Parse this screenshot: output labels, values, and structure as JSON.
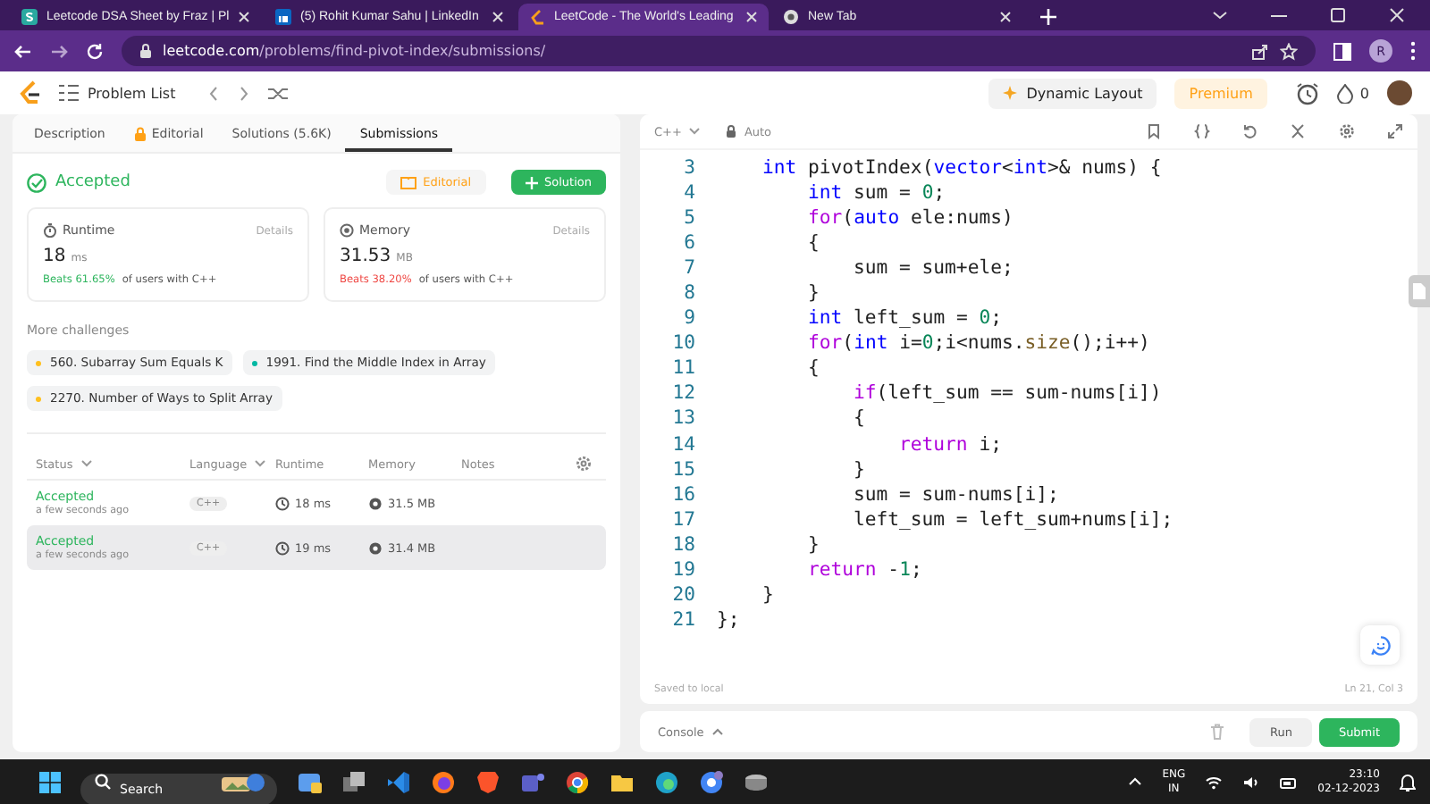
{
  "browser": {
    "tabs": [
      {
        "title": "Leetcode DSA Sheet by Fraz | Pl",
        "selected": false
      },
      {
        "title": "(5) Rohit Kumar Sahu | LinkedIn",
        "selected": false
      },
      {
        "title": "LeetCode - The World's Leading",
        "selected": true
      },
      {
        "title": "New Tab",
        "selected": false
      }
    ],
    "url_host": "leetcode.com",
    "url_path": "/problems/find-pivot-index/submissions/",
    "profile": "R"
  },
  "navbar": {
    "problem_list": "Problem List",
    "dynamic_layout": "Dynamic Layout",
    "premium": "Premium",
    "streak": "0"
  },
  "left": {
    "tabs": [
      {
        "label": "Description",
        "icon": false,
        "selected": false
      },
      {
        "label": "Editorial",
        "icon": true,
        "selected": false
      },
      {
        "label": "Solutions (5.6K)",
        "icon": false,
        "selected": false
      },
      {
        "label": "Submissions",
        "icon": false,
        "selected": true
      }
    ],
    "status": "Accepted",
    "editorial_button": "Editorial",
    "solution_button": "Solution",
    "stats": [
      {
        "kind": "runtime",
        "label": "Runtime",
        "details": "Details",
        "value": "18",
        "unit": "ms",
        "beats": "Beats 61.65%",
        "good": true,
        "suffix": "of users with C++"
      },
      {
        "kind": "memory",
        "label": "Memory",
        "details": "Details",
        "value": "31.53",
        "unit": "MB",
        "beats": "Beats 38.20%",
        "good": false,
        "suffix": "of users with C++"
      }
    ],
    "more_title": "More challenges",
    "challenges": [
      {
        "title": "560. Subarray Sum Equals K",
        "color": "#ffc01e"
      },
      {
        "title": "1991. Find the Middle Index in Array",
        "color": "#00b8a3"
      },
      {
        "title": "2270. Number of Ways to Split Array",
        "color": "#ffc01e"
      }
    ],
    "table": {
      "columns": [
        {
          "label": "Status",
          "sortable": true
        },
        {
          "label": "Language",
          "sortable": true
        },
        {
          "label": "Runtime",
          "sortable": false
        },
        {
          "label": "Memory",
          "sortable": false
        },
        {
          "label": "Notes",
          "sortable": false
        }
      ],
      "rows": [
        {
          "status": "Accepted",
          "time": "a few seconds ago",
          "language": "C++",
          "runtime": "18 ms",
          "memory": "31.5 MB"
        },
        {
          "status": "Accepted",
          "time": "a few seconds ago",
          "language": "C++",
          "runtime": "19 ms",
          "memory": "31.4 MB"
        }
      ]
    }
  },
  "editor": {
    "language": "C++",
    "mode": "Auto",
    "lines": [
      {
        "number": "3",
        "tokens": [
          {
            "text": "    int",
            "kind": "type"
          },
          {
            "text": " pivotIndex(",
            "kind": "plain"
          },
          {
            "text": "vector",
            "kind": "type"
          },
          {
            "text": "<",
            "kind": "plain"
          },
          {
            "text": "int",
            "kind": "type"
          },
          {
            "text": ">& nums) {",
            "kind": "plain"
          }
        ]
      },
      {
        "number": "4",
        "tokens": [
          {
            "text": "        int",
            "kind": "type"
          },
          {
            "text": " sum = ",
            "kind": "plain"
          },
          {
            "text": "0",
            "kind": "number"
          },
          {
            "text": ";",
            "kind": "plain"
          }
        ]
      },
      {
        "number": "5",
        "tokens": [
          {
            "text": "        for",
            "kind": "keyword"
          },
          {
            "text": "(",
            "kind": "plain"
          },
          {
            "text": "auto",
            "kind": "type"
          },
          {
            "text": " ele:nums)",
            "kind": "plain"
          }
        ]
      },
      {
        "number": "6",
        "tokens": [
          {
            "text": "        {",
            "kind": "plain"
          }
        ]
      },
      {
        "number": "7",
        "tokens": [
          {
            "text": "            sum = sum+ele;",
            "kind": "plain"
          }
        ]
      },
      {
        "number": "8",
        "tokens": [
          {
            "text": "        }",
            "kind": "plain"
          }
        ]
      },
      {
        "number": "9",
        "tokens": [
          {
            "text": "        int",
            "kind": "type"
          },
          {
            "text": " left_sum = ",
            "kind": "plain"
          },
          {
            "text": "0",
            "kind": "number"
          },
          {
            "text": ";",
            "kind": "plain"
          }
        ]
      },
      {
        "number": "10",
        "tokens": [
          {
            "text": "        for",
            "kind": "keyword"
          },
          {
            "text": "(",
            "kind": "plain"
          },
          {
            "text": "int",
            "kind": "type"
          },
          {
            "text": " i=",
            "kind": "plain"
          },
          {
            "text": "0",
            "kind": "number"
          },
          {
            "text": ";i<nums.",
            "kind": "plain"
          },
          {
            "text": "size",
            "kind": "function"
          },
          {
            "text": "();i++)",
            "kind": "plain"
          }
        ]
      },
      {
        "number": "11",
        "tokens": [
          {
            "text": "        {",
            "kind": "plain"
          }
        ]
      },
      {
        "number": "12",
        "tokens": [
          {
            "text": "            if",
            "kind": "keyword"
          },
          {
            "text": "(left_sum == sum-nums[i])",
            "kind": "plain"
          }
        ]
      },
      {
        "number": "13",
        "tokens": [
          {
            "text": "            {",
            "kind": "plain"
          }
        ]
      },
      {
        "number": "14",
        "tokens": [
          {
            "text": "                return",
            "kind": "keyword"
          },
          {
            "text": " i;",
            "kind": "plain"
          }
        ]
      },
      {
        "number": "15",
        "tokens": [
          {
            "text": "            }",
            "kind": "plain"
          }
        ]
      },
      {
        "number": "16",
        "tokens": [
          {
            "text": "            sum = sum-nums[i];",
            "kind": "plain"
          }
        ]
      },
      {
        "number": "17",
        "tokens": [
          {
            "text": "            left_sum = left_sum+nums[i];",
            "kind": "plain"
          }
        ]
      },
      {
        "number": "18",
        "tokens": [
          {
            "text": "        }",
            "kind": "plain"
          }
        ]
      },
      {
        "number": "19",
        "tokens": [
          {
            "text": "        return",
            "kind": "keyword"
          },
          {
            "text": " -",
            "kind": "plain"
          },
          {
            "text": "1",
            "kind": "number"
          },
          {
            "text": ";",
            "kind": "plain"
          }
        ]
      },
      {
        "number": "20",
        "tokens": [
          {
            "text": "    }",
            "kind": "plain"
          }
        ]
      },
      {
        "number": "21",
        "tokens": [
          {
            "text": "};",
            "kind": "plain"
          }
        ]
      }
    ],
    "saved": "Saved to local",
    "cursor": "Ln 21, Col 3",
    "console": "Console",
    "run": "Run",
    "submit": "Submit"
  },
  "taskbar": {
    "search_placeholder": "Search",
    "language": "ENG",
    "region": "IN",
    "time": "23:10",
    "date": "02-12-2023"
  }
}
